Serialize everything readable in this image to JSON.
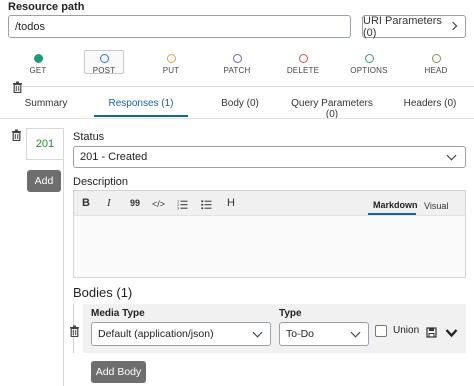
{
  "resource": {
    "label": "Resource path",
    "value": "/todos",
    "uri_params_button": "URI Parameters (0)"
  },
  "methods": [
    {
      "label": "GET",
      "color": "#1a9c7b",
      "filled": true
    },
    {
      "label": "POST",
      "color": "#2a73c9",
      "filled": false,
      "selected": true
    },
    {
      "label": "PUT",
      "color": "#e2a23b",
      "filled": false
    },
    {
      "label": "PATCH",
      "color": "#7a5fb5",
      "filled": false
    },
    {
      "label": "DELETE",
      "color": "#d9534f",
      "filled": false
    },
    {
      "label": "OPTIONS",
      "color": "#3aa36a",
      "filled": false
    },
    {
      "label": "HEAD",
      "color": "#8a8f55",
      "filled": false
    }
  ],
  "tabs": [
    {
      "label": "Summary"
    },
    {
      "label": "Responses (1)",
      "active": true
    },
    {
      "label": "Body (0)"
    },
    {
      "label": "Query Parameters (0)"
    },
    {
      "label": "Headers (0)"
    }
  ],
  "responses": {
    "code": "201",
    "add_label": "Add",
    "status_label": "Status",
    "status_value": "201 - Created",
    "description_label": "Description",
    "editor": {
      "mode_markdown": "Markdown",
      "mode_visual": "Visual",
      "toolbar": {
        "bold": "B",
        "italic": "I",
        "quote": "99",
        "code": "</>",
        "heading": "H"
      }
    }
  },
  "bodies": {
    "title": "Bodies (1)",
    "media_type_label": "Media Type",
    "media_type_value": "Default (application/json)",
    "type_label": "Type",
    "type_value": "To-Do",
    "union_label": "Union",
    "add_body_label": "Add Body"
  },
  "colors": {
    "accent": "#1f5fa8",
    "code_green": "#2a8a2a",
    "dark_button": "#6e6e6e"
  }
}
